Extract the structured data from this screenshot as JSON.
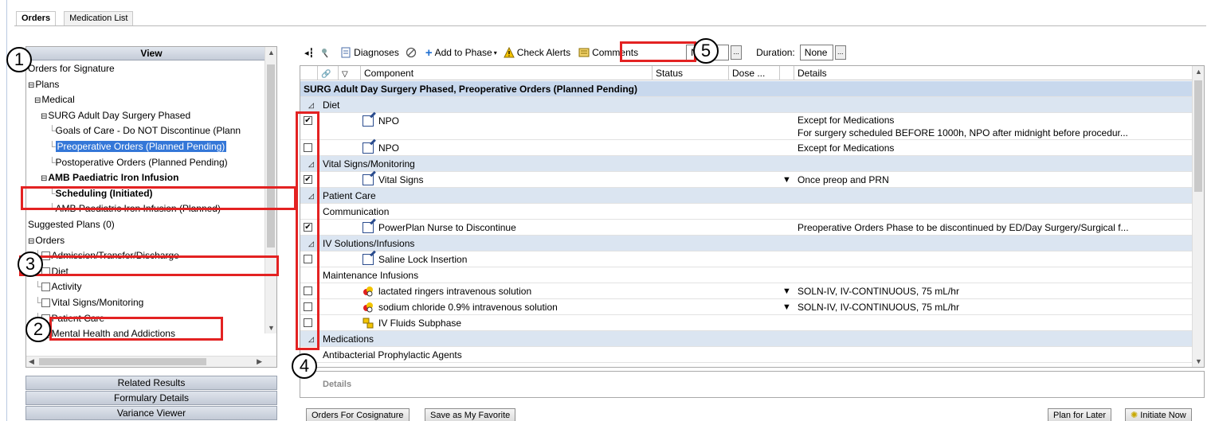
{
  "tabs": [
    "Orders",
    "Medication List"
  ],
  "view": {
    "header": "View",
    "tree": [
      {
        "label": "Orders for Signature",
        "indent": 0,
        "prefix": ""
      },
      {
        "label": "Plans",
        "indent": 0,
        "prefix": "⊟"
      },
      {
        "label": "Medical",
        "indent": 1,
        "prefix": "⊟"
      },
      {
        "label": "SURG Adult Day Surgery Phased",
        "indent": 2,
        "prefix": "⊟"
      },
      {
        "label": "Goals of Care - Do NOT Discontinue (Plann",
        "indent": 3,
        "prefix": ""
      },
      {
        "label": "Preoperative Orders (Planned Pending)",
        "indent": 3,
        "prefix": "",
        "selected": true
      },
      {
        "label": "Postoperative Orders (Planned Pending)",
        "indent": 3,
        "prefix": ""
      },
      {
        "label": "AMB Paediatric Iron Infusion",
        "indent": 2,
        "prefix": "⊟",
        "bold": true
      },
      {
        "label": "Scheduling (Initiated)",
        "indent": 3,
        "prefix": "",
        "bold": true
      },
      {
        "label": "AMB Paediatric Iron Infusion (Planned)",
        "indent": 3,
        "prefix": ""
      },
      {
        "label": "Suggested Plans (0)",
        "indent": 0,
        "prefix": ""
      },
      {
        "label": "Orders",
        "indent": 0,
        "prefix": "⊟"
      },
      {
        "label": "Admission/Transfer/Discharge",
        "indent": 1,
        "prefix": "",
        "checkbox": true
      },
      {
        "label": "Diet",
        "indent": 1,
        "prefix": "",
        "checkbox": true
      },
      {
        "label": "Activity",
        "indent": 1,
        "prefix": "",
        "checkbox": true
      },
      {
        "label": "Vital Signs/Monitoring",
        "indent": 1,
        "prefix": "",
        "checkbox": true
      },
      {
        "label": "Patient Care",
        "indent": 1,
        "prefix": "",
        "checkbox": true
      },
      {
        "label": "Mental Health and Addictions",
        "indent": 1,
        "prefix": "",
        "checkbox": true
      }
    ]
  },
  "left_buttons": [
    "Related Results",
    "Formulary Details",
    "Variance Viewer"
  ],
  "toolbar": {
    "diagnoses": "Diagnoses",
    "add_to_phase": "Add to Phase",
    "check_alerts": "Check Alerts",
    "comments": "Comments",
    "start_value": "Now",
    "duration_label": "Duration:",
    "duration_value": "None"
  },
  "grid": {
    "columns": [
      "",
      "",
      "Component",
      "Status",
      "Dose ...",
      "Details"
    ],
    "rows": [
      {
        "type": "band",
        "text": "SURG Adult Day Surgery Phased, Preoperative Orders (Planned Pending)"
      },
      {
        "type": "section",
        "text": "Diet"
      },
      {
        "type": "order",
        "checked": true,
        "icon": "order",
        "component": "NPO",
        "details": "Except for Medications",
        "details2": "For surgery scheduled BEFORE 1000h, NPO after midnight before procedur...",
        "tall": true
      },
      {
        "type": "order",
        "checked": false,
        "icon": "order",
        "component": "NPO",
        "details": "Except for Medications"
      },
      {
        "type": "section",
        "text": "Vital Signs/Monitoring"
      },
      {
        "type": "order",
        "checked": true,
        "icon": "order",
        "component": "Vital Signs",
        "details": "Once preop and PRN",
        "dropdown": true
      },
      {
        "type": "section",
        "text": "Patient Care"
      },
      {
        "type": "sub",
        "text": "Communication"
      },
      {
        "type": "order",
        "checked": true,
        "icon": "order",
        "component": "PowerPlan Nurse to Discontinue",
        "details": "Preoperative Orders Phase to be discontinued by ED/Day Surgery/Surgical f..."
      },
      {
        "type": "section",
        "text": "IV Solutions/Infusions"
      },
      {
        "type": "order",
        "checked": false,
        "icon": "order",
        "component": "Saline Lock Insertion",
        "details": ""
      },
      {
        "type": "sub",
        "text": "Maintenance Infusions"
      },
      {
        "type": "order",
        "checked": false,
        "icon": "med",
        "component": "lactated ringers intravenous solution",
        "details": "SOLN-IV, IV-CONTINUOUS, 75 mL/hr",
        "dropdown": true
      },
      {
        "type": "order",
        "checked": false,
        "icon": "med",
        "component": "sodium chloride 0.9% intravenous solution",
        "details": "SOLN-IV, IV-CONTINUOUS, 75 mL/hr",
        "dropdown": true
      },
      {
        "type": "order",
        "checked": false,
        "icon": "sub",
        "component": "IV Fluids Subphase",
        "details": ""
      },
      {
        "type": "section",
        "text": "Medications"
      },
      {
        "type": "sub",
        "text": "Antibacterial Prophylactic Agents"
      }
    ]
  },
  "details_label": "Details",
  "footer": {
    "cosignature": "Orders For Cosignature",
    "favorite": "Save as My Favorite",
    "plan_later": "Plan for Later",
    "initiate": "Initiate Now"
  },
  "callouts": [
    "1",
    "2",
    "3",
    "4",
    "5"
  ],
  "colors": {
    "callout_red": "#e32222",
    "selection_blue": "#3477d8",
    "band_blue": "#c8d8ed"
  }
}
